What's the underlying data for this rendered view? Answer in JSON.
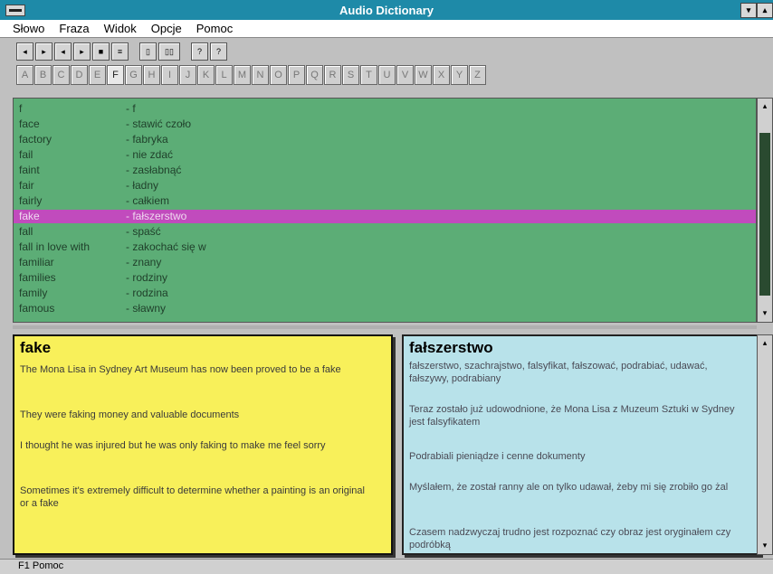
{
  "window": {
    "title": "Audio Dictionary"
  },
  "menu": [
    "Słowo",
    "Fraza",
    "Widok",
    "Opcje",
    "Pomoc"
  ],
  "toolbar": {
    "buttons": [
      "◂",
      "▸",
      "◂",
      "▸",
      "■",
      "≡",
      "▯",
      "▯▯",
      "?",
      "?"
    ]
  },
  "alphabet": [
    "A",
    "B",
    "C",
    "D",
    "E",
    "F",
    "G",
    "H",
    "I",
    "J",
    "K",
    "L",
    "M",
    "N",
    "O",
    "P",
    "Q",
    "R",
    "S",
    "T",
    "U",
    "V",
    "W",
    "X",
    "Y",
    "Z"
  ],
  "active_letter": "F",
  "word_list": [
    {
      "en": "f",
      "pl": "- f"
    },
    {
      "en": "face",
      "pl": "- stawić czoło"
    },
    {
      "en": "factory",
      "pl": "- fabryka"
    },
    {
      "en": "fail",
      "pl": "- nie zdać"
    },
    {
      "en": "faint",
      "pl": "- zasłabnąć"
    },
    {
      "en": "fair",
      "pl": "- ładny"
    },
    {
      "en": "fairly",
      "pl": "- całkiem"
    },
    {
      "en": "fake",
      "pl": "- fałszerstwo"
    },
    {
      "en": "fall",
      "pl": "- spaść"
    },
    {
      "en": "fall in love with",
      "pl": "- zakochać się w"
    },
    {
      "en": "familiar",
      "pl": "- znany"
    },
    {
      "en": "families",
      "pl": "- rodziny"
    },
    {
      "en": "family",
      "pl": "- rodzina"
    },
    {
      "en": "famous",
      "pl": "- sławny"
    }
  ],
  "selected_index": 7,
  "english_panel": {
    "headword": "fake",
    "examples": [
      "The Mona Lisa in Sydney Art Museum has now been proved to be a fake",
      "They were faking money and valuable documents",
      "I thought he was injured but he was only faking to make me feel sorry",
      "Sometimes it's extremely difficult to determine whether a painting is an original or a fake"
    ]
  },
  "polish_panel": {
    "headword": "fałszerstwo",
    "definition": "fałszerstwo, szachrajstwo, falsyfikat, fałszować, podrabiać, udawać, fałszywy, podrabiany",
    "examples": [
      "Teraz zostało już udowodnione, że Mona Lisa z Muzeum Sztuki w Sydney jest falsyfikatem",
      "Podrabiali pieniądze i cenne dokumenty",
      "Myślałem, że został ranny ale on tylko udawał, żeby mi się zrobiło go żal",
      "Czasem nadzwyczaj trudno jest rozpoznać czy obraz jest oryginałem czy podróbką"
    ]
  },
  "status": {
    "text": "F1 Pomoc"
  }
}
